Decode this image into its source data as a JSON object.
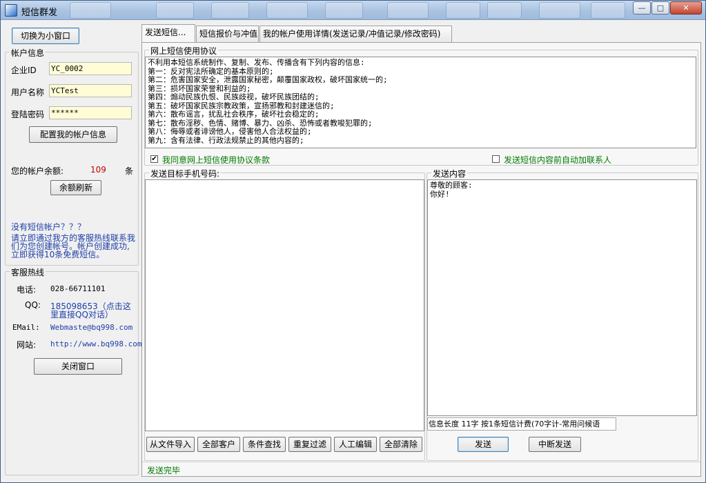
{
  "window": {
    "title": "短信群发"
  },
  "left": {
    "switch_button": "切换为小窗口",
    "account_group": "帐户信息",
    "company_id_label": "企业ID",
    "company_id_value": "YC_0002",
    "username_label": "用户名称",
    "username_value": "YCTest",
    "password_label": "登陆密码",
    "password_value": "******",
    "config_button": "配置我的帐户信息",
    "balance_label": "您的帐户余额:",
    "balance_value": "109",
    "balance_unit": "条",
    "refresh_button": "余额刷新",
    "promo_title": "没有短信帐户？？？",
    "promo_text": [
      "请立即通过我方的客服热线联系我",
      "们为您创建帐号。帐户创建成功,",
      "立即获得10条免费短信。"
    ],
    "hotline_group": "客服热线",
    "phone_label": "电话:",
    "phone_value": "028-66711101",
    "qq_label": "QQ:",
    "qq_value_1": "185098653（点击这",
    "qq_value_2": "里直接QQ对话）",
    "email_label": "EMail:",
    "email_value": "Webmaste@bq998.com",
    "site_label": "网站:",
    "site_value": "http://www.bq998.com",
    "close_button": "关闭窗口"
  },
  "tabs": [
    "发送短信...",
    "短信报价与冲值",
    "我的帐户使用详情(发送记录/冲值记录/修改密码)"
  ],
  "agreement": {
    "group": "网上短信使用协议",
    "lines": [
      "不利用本短信系统制作、复制、发布、传播含有下列内容的信息:",
      "第一：反对宪法所确定的基本原则的;",
      "第二：危害国家安全，泄露国家秘密，颠覆国家政权，破坏国家统一的;",
      "第三：损坏国家荣誉和利益的;",
      "第四：煽动民族仇恨、民族歧视，破坏民族团结的;",
      "第五：破坏国家民族宗教政策，宣扬邪教和封建迷信的;",
      "第六：散布谣言，扰乱社会秩序，破坏社会稳定的;",
      "第七：散布淫秽、色情、赌博、暴力、凶杀、恐怖或者教唆犯罪的;",
      "第八：侮辱或者诽谤他人，侵害他人合法权益的;",
      "第九：含有法律、行政法规禁止的其他内容的;"
    ],
    "agree_label": "我同意网上短信使用协议条款",
    "agree_checked": "✔",
    "auto_contact_label": "发送短信内容前自动加联系人"
  },
  "targets": {
    "group": "发送目标手机号码:",
    "buttons": [
      "从文件导入",
      "全部客户",
      "条件查找",
      "重复过滤",
      "人工编辑",
      "全部清除"
    ]
  },
  "message": {
    "group": "发送内容",
    "lines": [
      "尊敬的顾客:",
      "你好!"
    ],
    "info": "信息长度 11字 按1条短信计费(70字计-常用问候语",
    "send_button": "发送",
    "stop_button": "中断发送"
  },
  "status": {
    "text": "发送完毕"
  },
  "colors": {
    "accent_red": "#c00000",
    "link_blue": "#1e3ea8",
    "status_green": "#007a00",
    "field_yellow": "#fffcd6"
  }
}
